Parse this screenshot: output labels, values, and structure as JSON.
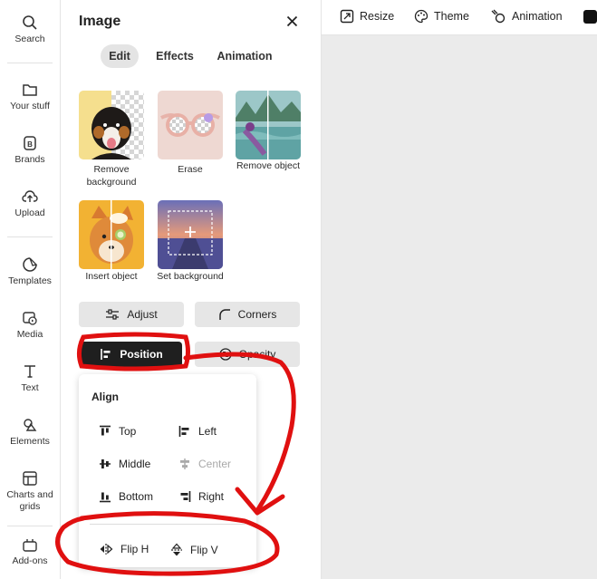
{
  "rail": {
    "items": [
      {
        "label": "Search",
        "icon": "search-icon"
      },
      {
        "label": "Your stuff",
        "icon": "folder-icon"
      },
      {
        "label": "Brands",
        "icon": "brand-icon"
      },
      {
        "label": "Upload",
        "icon": "upload-icon"
      },
      {
        "label": "Templates",
        "icon": "templates-icon"
      },
      {
        "label": "Media",
        "icon": "media-icon"
      },
      {
        "label": "Text",
        "icon": "text-icon"
      },
      {
        "label": "Elements",
        "icon": "elements-icon"
      },
      {
        "label": "Charts and grids",
        "icon": "charts-grid-icon"
      },
      {
        "label": "Add-ons",
        "icon": "addons-icon"
      }
    ]
  },
  "topbar": {
    "resize": "Resize",
    "theme": "Theme",
    "animation": "Animation"
  },
  "panel": {
    "title": "Image",
    "tabs": [
      {
        "label": "Edit",
        "active": true
      },
      {
        "label": "Effects",
        "active": false
      },
      {
        "label": "Animation",
        "active": false
      }
    ],
    "tools": [
      {
        "label": "Remove background"
      },
      {
        "label": "Erase"
      },
      {
        "label": "Remove object"
      },
      {
        "label": "Insert object"
      },
      {
        "label": "Set background"
      }
    ],
    "buttons": {
      "adjust": "Adjust",
      "corners": "Corners",
      "position": "Position",
      "opacity": "Opacity"
    }
  },
  "popover": {
    "heading": "Align",
    "align": {
      "top": "Top",
      "left": "Left",
      "middle": "Middle",
      "center": "Center",
      "bottom": "Bottom",
      "right": "Right"
    },
    "flip_h": "Flip H",
    "flip_v": "Flip V"
  },
  "annotation_color": "#e01010"
}
